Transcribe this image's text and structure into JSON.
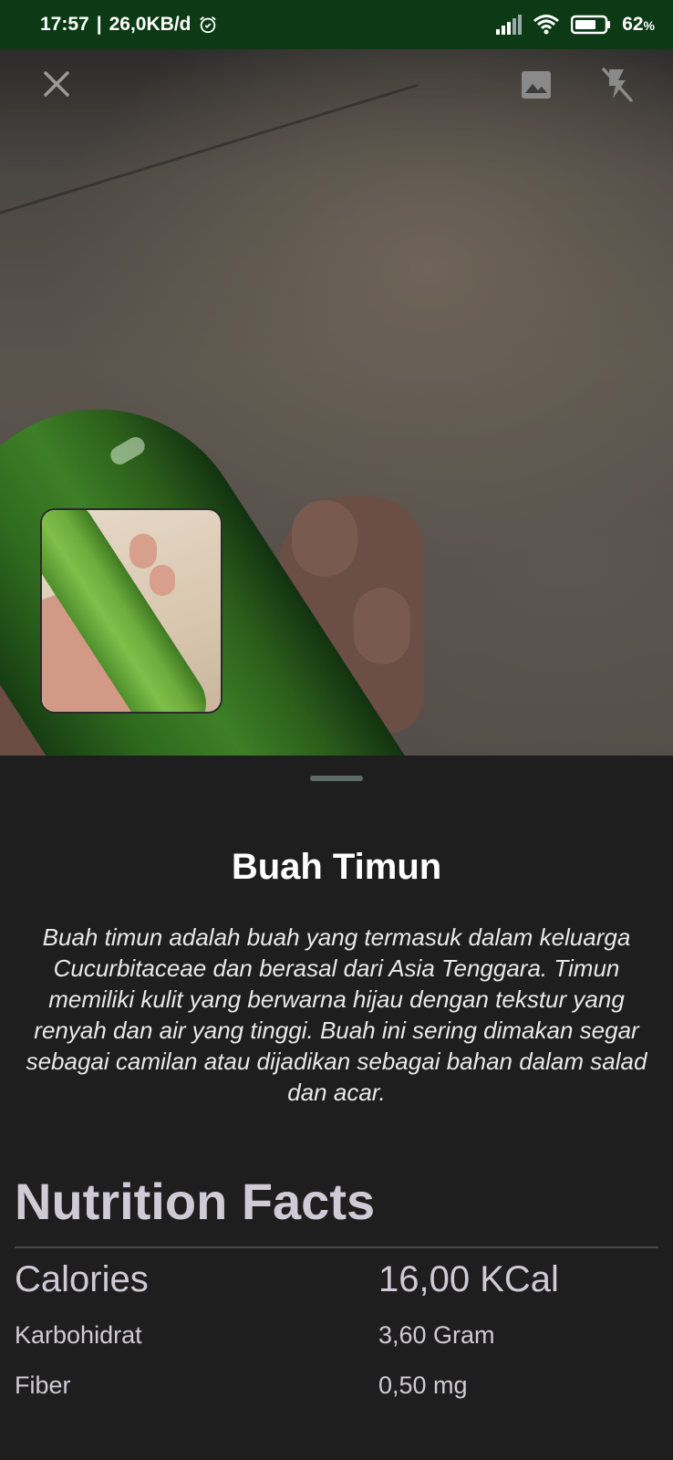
{
  "status_bar": {
    "time": "17:57",
    "network_speed": "26,0KB/d",
    "battery_percent": "62",
    "battery_unit": "%"
  },
  "camera": {
    "icons": {
      "close": "close-icon",
      "gallery": "image-icon",
      "flash": "flash-off-icon"
    }
  },
  "result": {
    "title": "Buah Timun",
    "description": "Buah timun adalah buah yang termasuk dalam keluarga Cucurbitaceae dan berasal dari Asia Tenggara. Timun memiliki kulit yang berwarna hijau dengan tekstur yang renyah dan air yang tinggi. Buah ini sering dimakan segar sebagai camilan atau dijadikan sebagai bahan dalam salad dan acar."
  },
  "nutrition": {
    "heading": "Nutrition Facts",
    "rows": [
      {
        "label": "Calories",
        "value": "16,00 KCal"
      },
      {
        "label": "Karbohidrat",
        "value": "3,60 Gram"
      },
      {
        "label": "Fiber",
        "value": "0,50 mg"
      }
    ]
  },
  "colors": {
    "status_bar": "#0b3a14",
    "sheet_bg": "#1e1e1e",
    "nutrition_text": "#cfcbd6"
  }
}
